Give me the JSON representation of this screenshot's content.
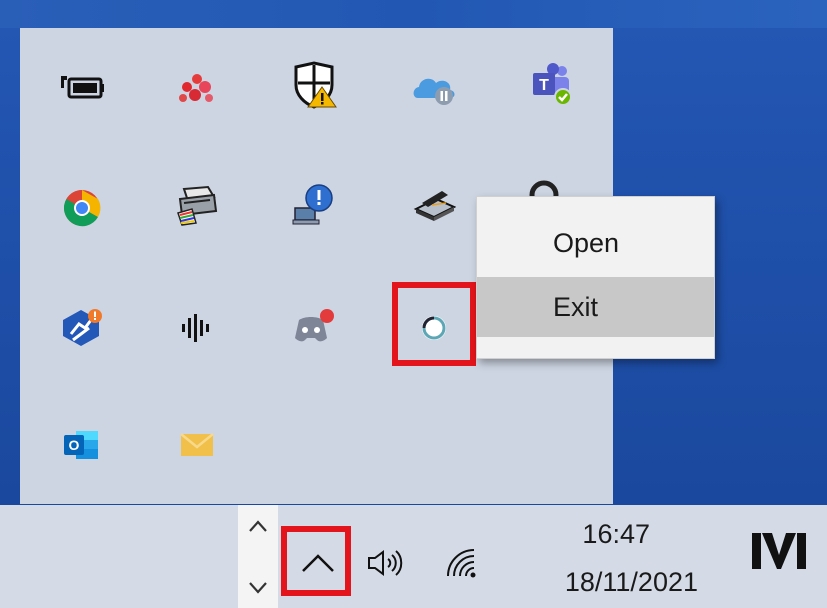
{
  "flyout": {
    "icons": [
      {
        "name": "battery-icon"
      },
      {
        "name": "red-dots-app-icon"
      },
      {
        "name": "windows-security-warning-icon"
      },
      {
        "name": "onedrive-paused-icon"
      },
      {
        "name": "teams-icon"
      },
      {
        "name": "chrome-icon"
      },
      {
        "name": "printer-icon"
      },
      {
        "name": "network-alert-icon"
      },
      {
        "name": "scanner-icon"
      },
      {
        "name": "partial-hidden-icon"
      },
      {
        "name": "security-app-icon"
      },
      {
        "name": "audio-waves-icon"
      },
      {
        "name": "discord-icon"
      },
      {
        "name": "loading-circle-app-icon"
      },
      {
        "name": "outlook-icon"
      },
      {
        "name": "mail-icon"
      }
    ]
  },
  "context_menu": {
    "items": [
      {
        "label": "Open"
      },
      {
        "label": "Exit"
      }
    ]
  },
  "taskbar": {
    "time": "16:47",
    "date": "18/11/2021",
    "logo": "M"
  },
  "colors": {
    "highlight": "#e3141b",
    "desktop": "#1f50aa",
    "flyout_bg": "#cdd5e3",
    "menu_hover": "#c8c8c8"
  }
}
